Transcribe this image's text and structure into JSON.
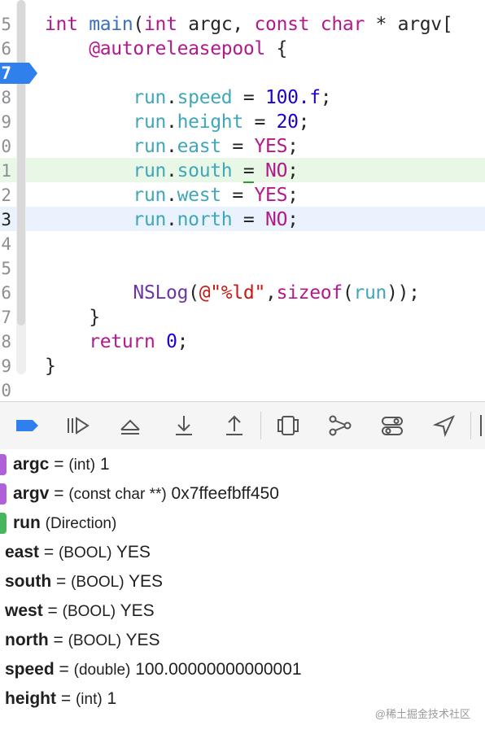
{
  "colors": {
    "keyword": "#b2198b",
    "identifier": "#3fa7b9",
    "number": "#1c00cf",
    "breakpoint": "#2f80ed",
    "green_highlight": "#e9f7e6",
    "blue_highlight": "#eaf2fd",
    "arg_badge": "#b061d7",
    "local_badge": "#47b55c"
  },
  "editor": {
    "lines": [
      {
        "num": "5",
        "code": "int main(int argc, const char * argv["
      },
      {
        "num": "6",
        "code": "@autoreleasepool {"
      },
      {
        "num": "7",
        "code": ""
      },
      {
        "num": "8",
        "code": "run.speed = 100.f;"
      },
      {
        "num": "9",
        "code": "run.height = 20;"
      },
      {
        "num": "0",
        "code": "run.east = YES;"
      },
      {
        "num": "1",
        "code": "run.south = NO;"
      },
      {
        "num": "2",
        "code": "run.west = YES;"
      },
      {
        "num": "3",
        "code": "run.north = NO;"
      },
      {
        "num": "4",
        "code": ""
      },
      {
        "num": "5",
        "code": ""
      },
      {
        "num": "6",
        "code": "NSLog(@\"%ld\",sizeof(run));"
      },
      {
        "num": "7",
        "code": "}"
      },
      {
        "num": "8",
        "code": "return 0;"
      },
      {
        "num": "9",
        "code": "}"
      },
      {
        "num": "0",
        "code": ""
      }
    ],
    "breakpoint_line": "7"
  },
  "toolbar": {
    "buttons": [
      {
        "name": "breakpoint-toggle-icon"
      },
      {
        "name": "continue-icon"
      },
      {
        "name": "step-over-icon"
      },
      {
        "name": "step-into-icon"
      },
      {
        "name": "step-out-icon"
      },
      {
        "name": "view-hierarchy-icon"
      },
      {
        "name": "memory-graph-icon"
      },
      {
        "name": "environment-overrides-icon"
      },
      {
        "name": "simulate-location-icon"
      }
    ]
  },
  "variables": [
    {
      "name": "argc",
      "eq": "=",
      "type": "(int)",
      "value": "1",
      "badge": "arg"
    },
    {
      "name": "argv",
      "eq": "=",
      "type": "(const char **)",
      "value": "0x7ffeefbff450",
      "badge": "arg"
    },
    {
      "name": "run",
      "eq": "",
      "type": "(Direction)",
      "value": "",
      "badge": "local"
    },
    {
      "name": "east",
      "eq": "=",
      "type": "(BOOL)",
      "value": "YES",
      "badge": ""
    },
    {
      "name": "south",
      "eq": "=",
      "type": "(BOOL)",
      "value": "YES",
      "badge": ""
    },
    {
      "name": "west",
      "eq": "=",
      "type": "(BOOL)",
      "value": "YES",
      "badge": ""
    },
    {
      "name": "north",
      "eq": "=",
      "type": "(BOOL)",
      "value": "YES",
      "badge": ""
    },
    {
      "name": "speed",
      "eq": "=",
      "type": "(double)",
      "value": "100.00000000000001",
      "badge": ""
    },
    {
      "name": "height",
      "eq": "=",
      "type": "(int)",
      "value": "1",
      "badge": ""
    }
  ],
  "watermark": "@稀土掘金技术社区"
}
